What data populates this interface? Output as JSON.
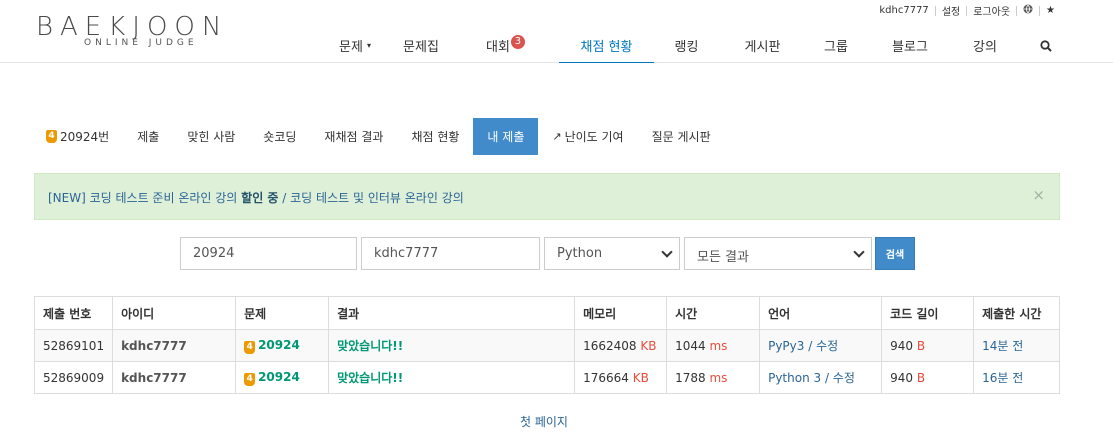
{
  "logo": {
    "main": "BAEKJOON",
    "sub": "ONLINE JUDGE"
  },
  "util": {
    "user": "kdhc7777",
    "settings": "설정",
    "logout": "로그아웃"
  },
  "nav": [
    {
      "label": "문제"
    },
    {
      "label": "문제집"
    },
    {
      "label": "대회",
      "badge": "3"
    },
    {
      "label": "채점 현황",
      "active": true
    },
    {
      "label": "랭킹"
    },
    {
      "label": "게시판"
    },
    {
      "label": "그룹"
    },
    {
      "label": "블로그"
    },
    {
      "label": "강의"
    }
  ],
  "subnav": [
    {
      "label": "20924번",
      "level": "4"
    },
    {
      "label": "제출"
    },
    {
      "label": "맞힌 사람"
    },
    {
      "label": "숏코딩"
    },
    {
      "label": "재채점 결과"
    },
    {
      "label": "채점 현황"
    },
    {
      "label": "내 제출",
      "active": true
    },
    {
      "label": "난이도 기여"
    },
    {
      "label": "질문 게시판"
    }
  ],
  "alert": {
    "prefix": "[NEW] 코딩 테스트 준비 온라인 강의 ",
    "bold": "할인 중",
    "mid": " / 코딩 테스트 및 인터뷰 온라인 강의",
    "close": "×"
  },
  "form": {
    "problem": "20924",
    "user": "kdhc7777",
    "language": "Python",
    "result": "모든 결과",
    "search": "검색"
  },
  "table": {
    "headers": [
      "제출 번호",
      "아이디",
      "문제",
      "결과",
      "메모리",
      "시간",
      "언어",
      "코드 길이",
      "제출한 시간"
    ],
    "rows": [
      {
        "id": "52869101",
        "user": "kdhc7777",
        "level": "4",
        "problem": "20924",
        "result": "맞았습니다!!",
        "memory": "1662408",
        "memory_unit": "KB",
        "time": "1044",
        "time_unit": "ms",
        "lang": "PyPy3",
        "edit": "수정",
        "len": "940",
        "len_unit": "B",
        "submitted": "14분 전"
      },
      {
        "id": "52869009",
        "user": "kdhc7777",
        "level": "4",
        "problem": "20924",
        "result": "맞았습니다!!",
        "memory": "176664",
        "memory_unit": "KB",
        "time": "1788",
        "time_unit": "ms",
        "lang": "Python 3",
        "edit": "수정",
        "len": "940",
        "len_unit": "B",
        "submitted": "16분 전"
      }
    ]
  },
  "pager": {
    "first": "첫 페이지"
  }
}
